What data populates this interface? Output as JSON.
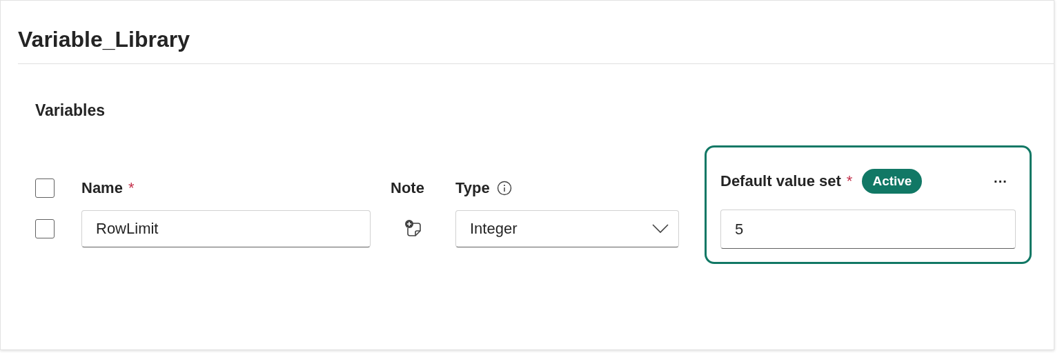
{
  "title": "Variable_Library",
  "section": {
    "title": "Variables"
  },
  "columns": [
    {
      "kind": "select",
      "checked": false
    },
    {
      "kind": "name",
      "label": "Name",
      "required_mark": "*"
    },
    {
      "kind": "note",
      "label": "Note"
    },
    {
      "kind": "type",
      "label": "Type"
    }
  ],
  "rows": [
    {
      "checked": false,
      "name": "RowLimit",
      "type": "Integer"
    }
  ],
  "value_set": {
    "label": "Default value set",
    "required_mark": "*",
    "badge": "Active",
    "selected": true,
    "menu": "···",
    "values": [
      "5"
    ]
  }
}
